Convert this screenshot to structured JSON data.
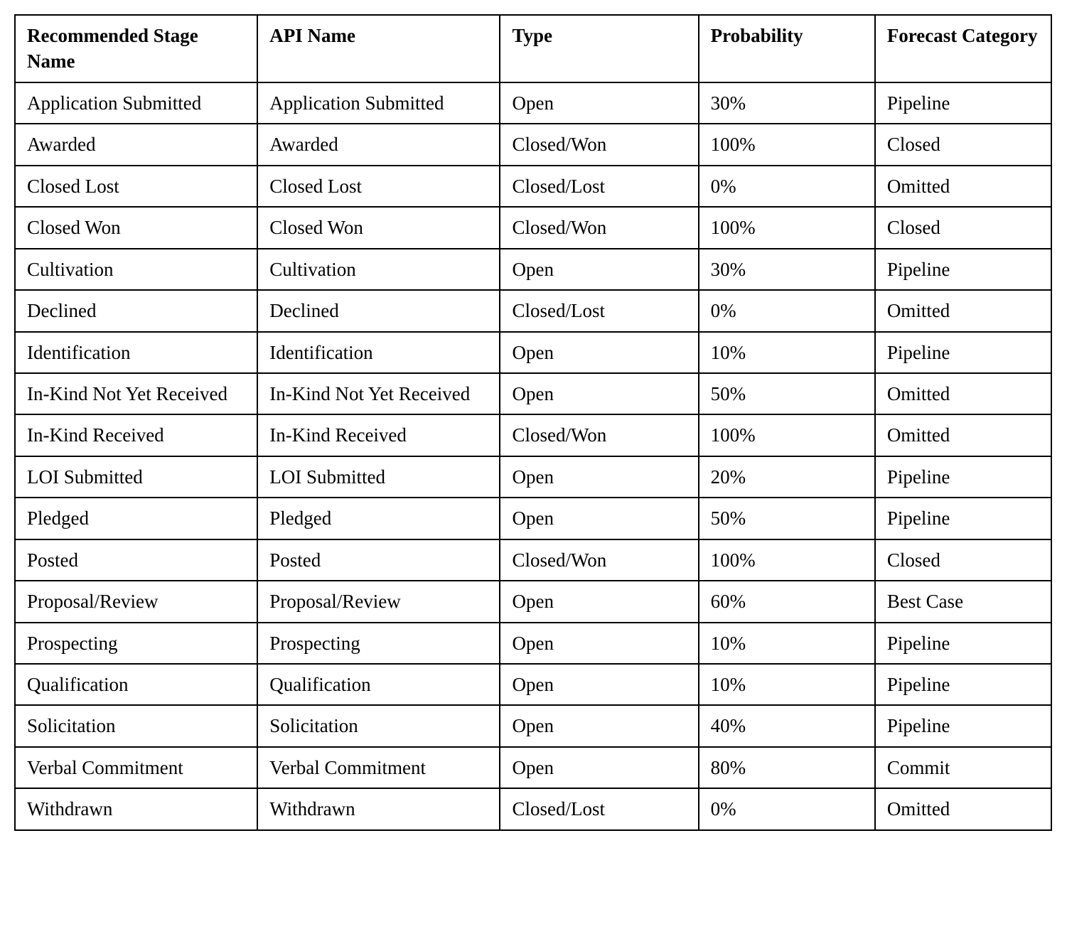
{
  "table": {
    "headers": [
      "Recommended Stage Name",
      "API Name",
      "Type",
      "Probability",
      "Forecast Category"
    ],
    "rows": [
      {
        "stage": "Application Submitted",
        "api": "Application Submitted",
        "type": "Open",
        "probability": "30%",
        "forecast": "Pipeline"
      },
      {
        "stage": "Awarded",
        "api": "Awarded",
        "type": "Closed/Won",
        "probability": "100%",
        "forecast": "Closed"
      },
      {
        "stage": "Closed Lost",
        "api": "Closed Lost",
        "type": "Closed/Lost",
        "probability": "0%",
        "forecast": "Omitted"
      },
      {
        "stage": "Closed Won",
        "api": "Closed Won",
        "type": "Closed/Won",
        "probability": "100%",
        "forecast": "Closed"
      },
      {
        "stage": "Cultivation",
        "api": "Cultivation",
        "type": "Open",
        "probability": "30%",
        "forecast": "Pipeline"
      },
      {
        "stage": "Declined",
        "api": "Declined",
        "type": "Closed/Lost",
        "probability": "0%",
        "forecast": "Omitted"
      },
      {
        "stage": "Identification",
        "api": "Identification",
        "type": "Open",
        "probability": "10%",
        "forecast": "Pipeline"
      },
      {
        "stage": "In-Kind Not Yet Received",
        "api": "In-Kind Not Yet Received",
        "type": "Open",
        "probability": "50%",
        "forecast": "Omitted"
      },
      {
        "stage": "In-Kind Received",
        "api": "In-Kind Received",
        "type": "Closed/Won",
        "probability": "100%",
        "forecast": "Omitted"
      },
      {
        "stage": "LOI Submitted",
        "api": "LOI Submitted",
        "type": "Open",
        "probability": "20%",
        "forecast": "Pipeline"
      },
      {
        "stage": "Pledged",
        "api": "Pledged",
        "type": "Open",
        "probability": "50%",
        "forecast": "Pipeline"
      },
      {
        "stage": "Posted",
        "api": "Posted",
        "type": "Closed/Won",
        "probability": "100%",
        "forecast": "Closed"
      },
      {
        "stage": "Proposal/Review",
        "api": "Proposal/Review",
        "type": "Open",
        "probability": "60%",
        "forecast": "Best Case"
      },
      {
        "stage": "Prospecting",
        "api": "Prospecting",
        "type": "Open",
        "probability": "10%",
        "forecast": "Pipeline"
      },
      {
        "stage": "Qualification",
        "api": "Qualification",
        "type": "Open",
        "probability": "10%",
        "forecast": "Pipeline"
      },
      {
        "stage": "Solicitation",
        "api": "Solicitation",
        "type": "Open",
        "probability": "40%",
        "forecast": "Pipeline"
      },
      {
        "stage": "Verbal Commitment",
        "api": "Verbal Commitment",
        "type": "Open",
        "probability": "80%",
        "forecast": "Commit"
      },
      {
        "stage": "Withdrawn",
        "api": "Withdrawn",
        "type": "Closed/Lost",
        "probability": "0%",
        "forecast": "Omitted"
      }
    ]
  }
}
